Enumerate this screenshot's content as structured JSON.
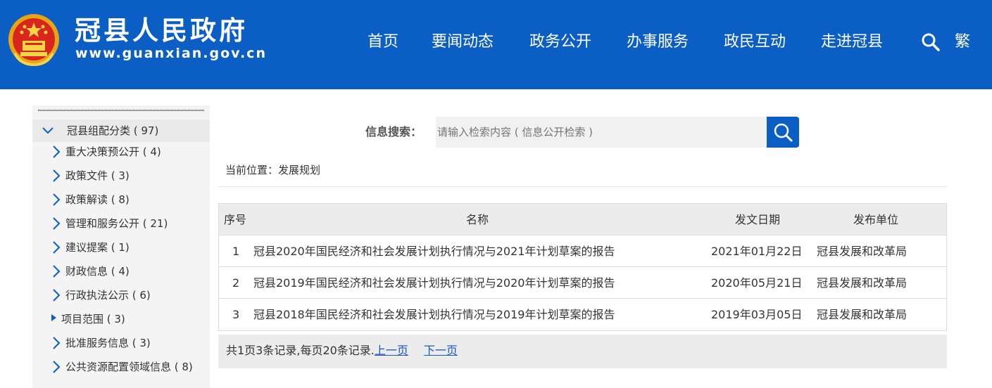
{
  "header": {
    "site_title": "冠县人民政府",
    "site_url": "www.guanxian.gov.cn",
    "nav": [
      "首页",
      "要闻动态",
      "政务公开",
      "办事服务",
      "政民互动",
      "走进冠县"
    ],
    "search_icon": "search-icon",
    "traditional_label": "繁",
    "colors": {
      "header_bg": "#0b5ec4",
      "text": "#ffffff"
    }
  },
  "sidebar": {
    "category_head": "冠县组配分类 ( 97)",
    "items": [
      {
        "label": "重大决策预公开 ( 4)",
        "icon": "chevron-right-icon"
      },
      {
        "label": "政策文件 ( 3)",
        "icon": "chevron-right-icon"
      },
      {
        "label": "政策解读 ( 8)",
        "icon": "chevron-right-icon"
      },
      {
        "label": "管理和服务公开 ( 21)",
        "icon": "chevron-right-icon"
      },
      {
        "label": "建议提案 ( 1)",
        "icon": "chevron-right-icon"
      },
      {
        "label": "财政信息 ( 4)",
        "icon": "chevron-right-icon"
      },
      {
        "label": "行政执法公示 ( 6)",
        "icon": "chevron-right-icon"
      },
      {
        "label": "项目范围 ( 3)",
        "icon": "triangle-right-icon"
      },
      {
        "label": "批准服务信息 ( 3)",
        "icon": "chevron-right-icon"
      },
      {
        "label": "公共资源配置领域信息 ( 8)",
        "icon": "chevron-right-icon"
      }
    ]
  },
  "search": {
    "label": "信息搜索：",
    "placeholder": "请输入检索内容 ( 信息公开检索 )"
  },
  "breadcrumb": "当前位置：发展规划",
  "table": {
    "headers": {
      "num": "序号",
      "name": "名称",
      "date": "发文日期",
      "unit": "发布单位"
    },
    "rows": [
      {
        "num": "1",
        "name": "冠县2020年国民经济和社会发展计划执行情况与2021年计划草案的报告",
        "date": "2021年01月22日",
        "unit": "冠县发展和改革局"
      },
      {
        "num": "2",
        "name": "冠县2019年国民经济和社会发展计划执行情况与2020年计划草案的报告",
        "date": "2020年05月21日",
        "unit": "冠县发展和改革局"
      },
      {
        "num": "3",
        "name": "冠县2018年国民经济和社会发展计划执行情况与2019年计划草案的报告",
        "date": "2019年03月05日",
        "unit": "冠县发展和改革局"
      }
    ]
  },
  "pager": {
    "summary": "共1页3条记录,每页20条记录.",
    "prev": "上一页",
    "next": "下一页"
  }
}
